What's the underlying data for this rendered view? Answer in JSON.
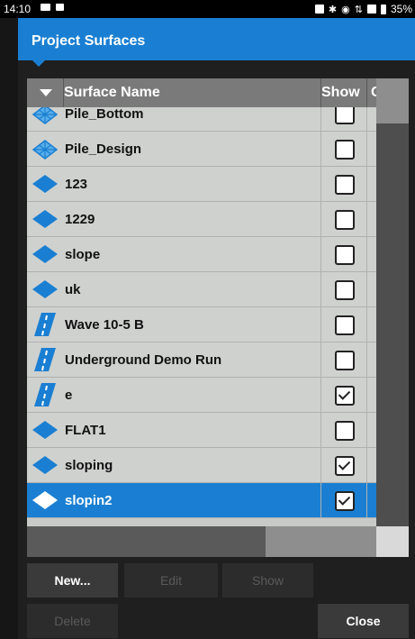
{
  "status": {
    "time": "14:10",
    "battery": "35%"
  },
  "title": "Project Surfaces",
  "table": {
    "headers": {
      "name": "Surface Name",
      "show": "Show",
      "extra": "C"
    },
    "rows": [
      {
        "name": "Pile_Bottom",
        "icon": "tin-surface-icon",
        "show": false,
        "selected": false
      },
      {
        "name": "Pile_Design",
        "icon": "tin-surface-icon",
        "show": false,
        "selected": false
      },
      {
        "name": "123",
        "icon": "diamond-surface-icon",
        "show": false,
        "selected": false
      },
      {
        "name": "1229",
        "icon": "diamond-surface-icon",
        "show": false,
        "selected": false
      },
      {
        "name": "slope",
        "icon": "diamond-surface-icon",
        "show": false,
        "selected": false
      },
      {
        "name": "uk",
        "icon": "diamond-surface-icon",
        "show": false,
        "selected": false
      },
      {
        "name": "Wave 10-5 B",
        "icon": "road-surface-icon",
        "show": false,
        "selected": false
      },
      {
        "name": "Underground Demo Run",
        "icon": "road-surface-icon",
        "show": false,
        "selected": false
      },
      {
        "name": "e",
        "icon": "road-surface-icon",
        "show": true,
        "selected": false
      },
      {
        "name": "FLAT1",
        "icon": "diamond-surface-icon",
        "show": false,
        "selected": false
      },
      {
        "name": "sloping",
        "icon": "diamond-surface-icon",
        "show": true,
        "selected": false
      },
      {
        "name": "slopin2",
        "icon": "diamond-surface-icon",
        "show": true,
        "selected": true
      }
    ]
  },
  "buttons": {
    "new": "New...",
    "edit": "Edit",
    "show": "Show",
    "delete": "Delete",
    "close": "Close"
  },
  "colors": {
    "accent": "#1a7fd2",
    "row": "#cfd1cf",
    "background": "#1f1f1f"
  }
}
